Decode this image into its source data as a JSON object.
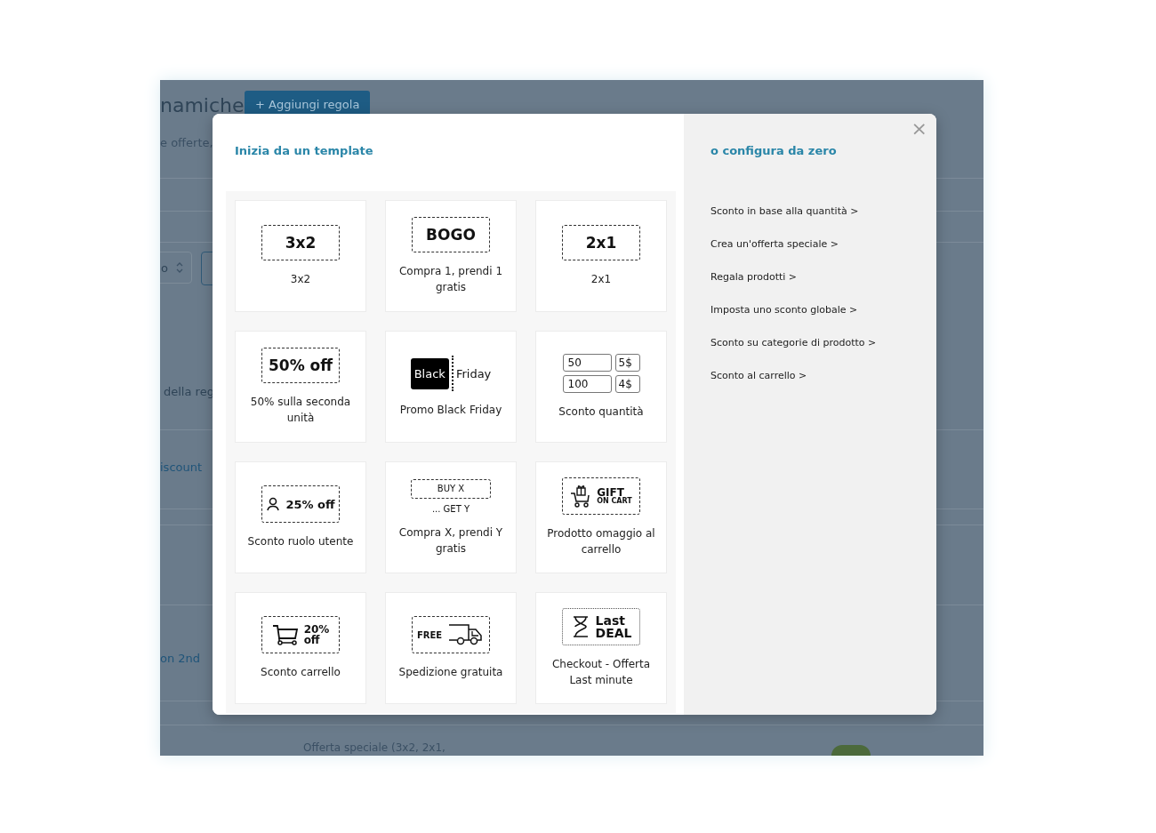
{
  "background_page": {
    "title": "namiche",
    "add_button": "+ Aggiungi regola",
    "subtitle": "e offerte,",
    "select_value": "o",
    "column_label": "della reg",
    "rule_names": [
      "iscount",
      "on 2nd"
    ],
    "row_description": "Offerta speciale (3x2, 2x1,",
    "toggle_on": true
  },
  "modal": {
    "close": "×",
    "templates_heading": "Inizia da un template",
    "templates": [
      {
        "label": "3x2",
        "badge": {
          "kind": "text",
          "texts": [
            "3x2"
          ]
        }
      },
      {
        "label": "Compra 1, prendi 1 gratis",
        "badge": {
          "kind": "text",
          "texts": [
            "BOGO"
          ]
        }
      },
      {
        "label": "2x1",
        "badge": {
          "kind": "text",
          "texts": [
            "2x1"
          ]
        }
      },
      {
        "label": "50% sulla seconda unità",
        "badge": {
          "kind": "text",
          "texts": [
            "50% off"
          ]
        }
      },
      {
        "label": "Promo Black Friday",
        "badge": {
          "kind": "black_friday",
          "texts": [
            "Black",
            "Friday"
          ]
        }
      },
      {
        "label": "Sconto quantità",
        "badge": {
          "kind": "quantity_table",
          "texts": [
            "50",
            "5$",
            "100",
            "4$"
          ]
        }
      },
      {
        "label": "Sconto ruolo utente",
        "badge": {
          "kind": "user",
          "texts": [
            "25% off"
          ]
        }
      },
      {
        "label": "Compra X, prendi Y gratis",
        "badge": {
          "kind": "buy_get",
          "texts": [
            "BUY X",
            "... GET Y"
          ]
        }
      },
      {
        "label": "Prodotto omaggio al carrello",
        "badge": {
          "kind": "gift",
          "texts": [
            "GIFT",
            "ON CART"
          ]
        }
      },
      {
        "label": "Sconto carrello",
        "badge": {
          "kind": "cart",
          "texts": [
            "20%",
            "off"
          ]
        }
      },
      {
        "label": "Spedizione gratuita",
        "badge": {
          "kind": "truck",
          "texts": [
            "FREE"
          ]
        }
      },
      {
        "label": "Checkout - Offerta Last minute",
        "badge": {
          "kind": "hourglass",
          "texts": [
            "Last",
            "DEAL"
          ]
        }
      }
    ],
    "scratch_heading": "o configura da zero",
    "scratch_links": [
      "Sconto in base alla quantità >",
      "Crea un'offerta speciale >",
      "Regala prodotti >",
      "Imposta uno sconto globale >",
      "Sconto su categorie di prodotto >",
      "Sconto al carrello >"
    ]
  }
}
